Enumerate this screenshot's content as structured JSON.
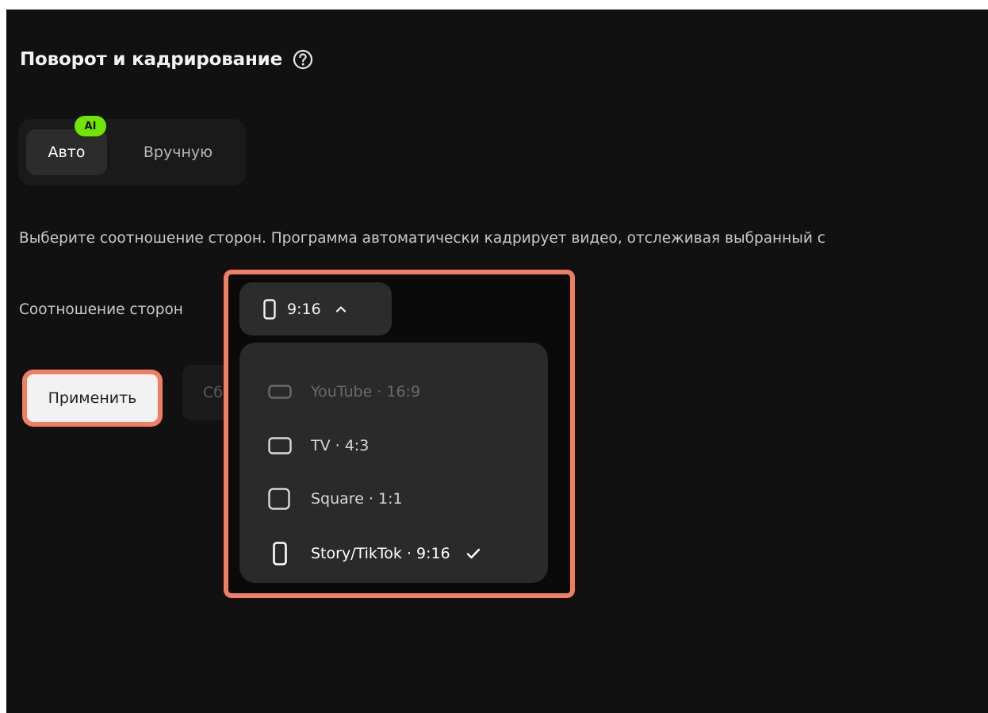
{
  "panel": {
    "title": "Поворот и кадрирование",
    "help_icon": "question-circle-icon"
  },
  "mode": {
    "badge": "AI",
    "tabs": [
      {
        "label": "Авто",
        "active": true
      },
      {
        "label": "Вручную",
        "active": false
      }
    ]
  },
  "description": "Выберите соотношение сторон. Программа автоматически кадрирует видео, отслеживая выбранный с",
  "aspect": {
    "label": "Соотношение сторон",
    "selected_value": "9:16",
    "selected_icon": "portrait-device-icon",
    "chevron_icon": "chevron-up-icon",
    "options": [
      {
        "label": "YouTube · 16:9",
        "icon": "landscape-icon",
        "state": "disabled"
      },
      {
        "label": "TV · 4:3",
        "icon": "tv-icon",
        "state": "normal"
      },
      {
        "label": "Square · 1:1",
        "icon": "square-icon",
        "state": "normal"
      },
      {
        "label": "Story/TikTok · 9:16",
        "icon": "portrait-device-icon",
        "state": "selected"
      }
    ]
  },
  "buttons": {
    "apply": "Применить",
    "reset": "Сбро"
  },
  "colors": {
    "background": "#111111",
    "highlight": "#f07e60",
    "ai_badge": "#6fe600",
    "dropdown": "#2a2a2a"
  }
}
